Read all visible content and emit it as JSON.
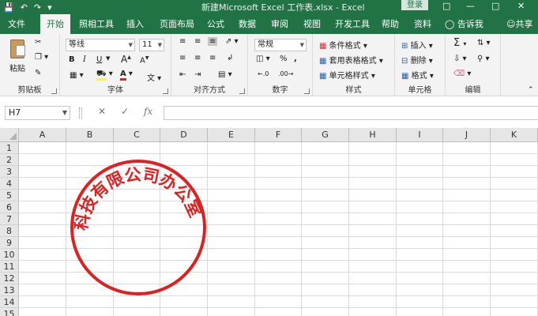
{
  "app": {
    "title": "新建Microsoft Excel 工作表.xlsx  -  Excel",
    "login_label": "登录"
  },
  "tabs": [
    {
      "label": "文件"
    },
    {
      "label": "开始"
    },
    {
      "label": "照相工具"
    },
    {
      "label": "插入"
    },
    {
      "label": "页面布局"
    },
    {
      "label": "公式"
    },
    {
      "label": "数据"
    },
    {
      "label": "审阅"
    },
    {
      "label": "视图"
    },
    {
      "label": "开发工具"
    },
    {
      "label": "帮助"
    },
    {
      "label": "资料"
    }
  ],
  "tell_me": "告诉我",
  "share": "共享",
  "ribbon": {
    "clipboard": {
      "paste_label": "粘贴",
      "group_label": "剪贴板"
    },
    "font": {
      "font_name": "等线",
      "font_size": "11",
      "group_label": "字体"
    },
    "alignment": {
      "group_label": "对齐方式"
    },
    "number": {
      "format": "常规",
      "group_label": "数字"
    },
    "styles": {
      "conditional_formatting": "条件格式",
      "format_as_table": "套用表格格式",
      "cell_styles": "单元格样式",
      "group_label": "样式"
    },
    "cells": {
      "insert": "插入",
      "delete": "删除",
      "format": "格式",
      "group_label": "单元格"
    },
    "editing": {
      "group_label": "编辑"
    }
  },
  "formula_bar": {
    "name_box": "H7",
    "formula": ""
  },
  "columns": [
    "A",
    "B",
    "C",
    "D",
    "E",
    "F",
    "G",
    "H",
    "I",
    "J",
    "K"
  ],
  "rows": [
    "1",
    "2",
    "3",
    "4",
    "5",
    "6",
    "7",
    "8",
    "9",
    "10",
    "11",
    "12",
    "13",
    "14",
    "15"
  ],
  "stamp": {
    "text": "科技有限公司办公室",
    "color": "#e02020"
  },
  "colors": {
    "accent": "#217346",
    "ribbon_bg": "#f3f3f3"
  }
}
